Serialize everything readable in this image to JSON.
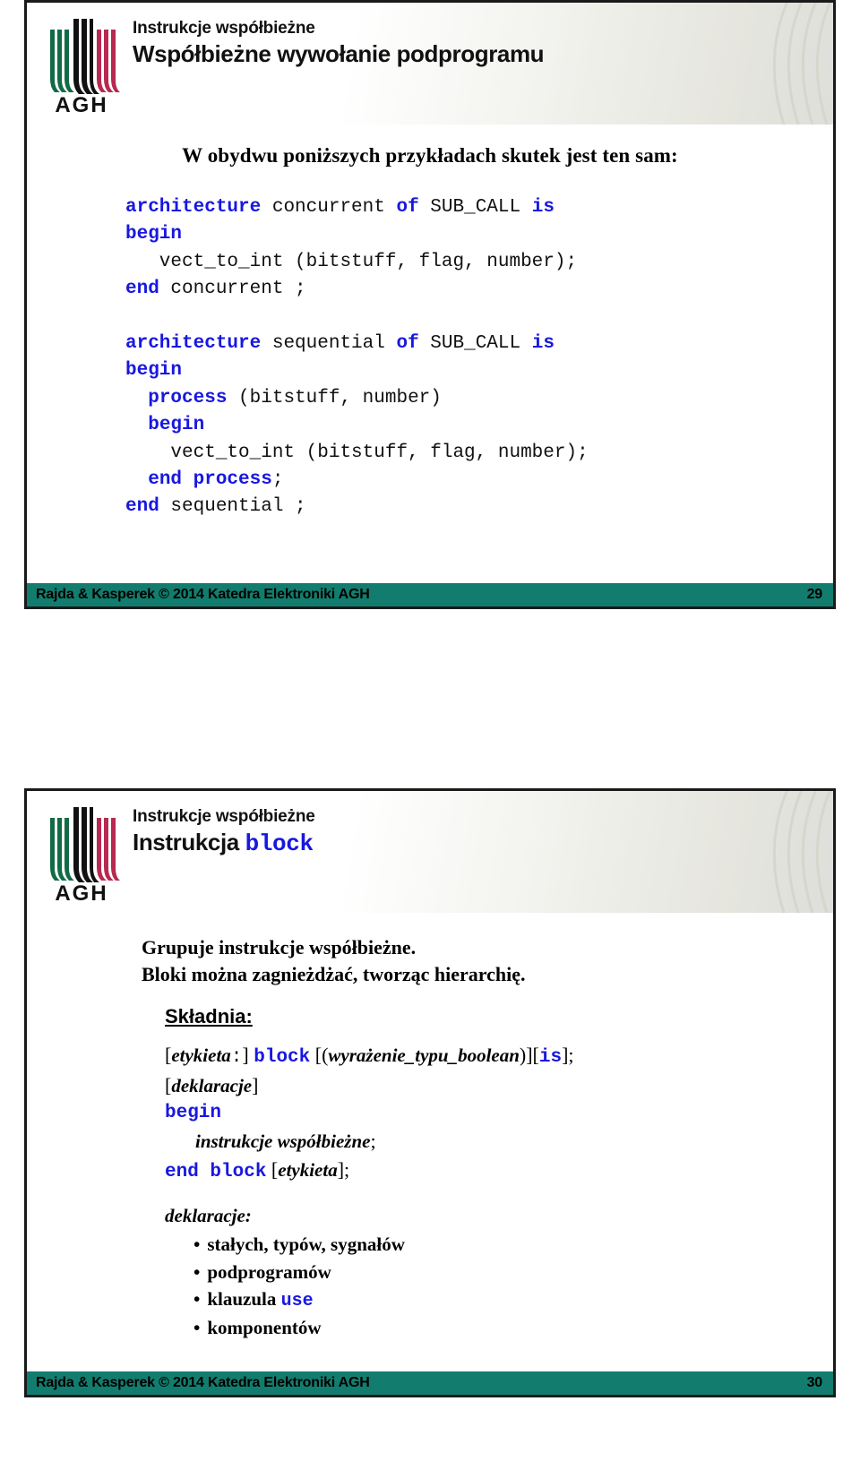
{
  "document": {
    "slides": [
      {
        "id": "slide-29",
        "header": {
          "kicker": "Instrukcje współbieżne",
          "title": "Współbieżne wywołanie podprogramu",
          "logo_text": "AGH",
          "logo_name": "agh-logo"
        },
        "lead": "W obydwu poniższych przykładach skutek jest ten sam:",
        "code_blocks": [
          {
            "name": "concurrent-example",
            "lines": [
              [
                {
                  "t": "architecture",
                  "c": "kw"
                },
                {
                  "t": " concurrent ",
                  "c": "id"
                },
                {
                  "t": "of",
                  "c": "kw"
                },
                {
                  "t": " SUB_CALL ",
                  "c": "id"
                },
                {
                  "t": "is",
                  "c": "kw"
                }
              ],
              [
                {
                  "t": "begin",
                  "c": "kw"
                }
              ],
              [
                {
                  "t": "   vect_to_int (bitstuff, flag, number);",
                  "c": "id"
                }
              ],
              [
                {
                  "t": "end",
                  "c": "kw"
                },
                {
                  "t": " concurrent ;",
                  "c": "id"
                }
              ]
            ]
          },
          {
            "name": "sequential-example",
            "lines": [
              [
                {
                  "t": "architecture",
                  "c": "kw"
                },
                {
                  "t": " sequential ",
                  "c": "id"
                },
                {
                  "t": "of",
                  "c": "kw"
                },
                {
                  "t": " SUB_CALL ",
                  "c": "id"
                },
                {
                  "t": "is",
                  "c": "kw"
                }
              ],
              [
                {
                  "t": "begin",
                  "c": "kw"
                }
              ],
              [
                {
                  "t": "  ",
                  "c": "id"
                },
                {
                  "t": "process",
                  "c": "kw"
                },
                {
                  "t": " (bitstuff, number)",
                  "c": "id"
                }
              ],
              [
                {
                  "t": "  ",
                  "c": "id"
                },
                {
                  "t": "begin",
                  "c": "kw"
                }
              ],
              [
                {
                  "t": "    vect_to_int (bitstuff, flag, number);",
                  "c": "id"
                }
              ],
              [
                {
                  "t": "  ",
                  "c": "id"
                },
                {
                  "t": "end process",
                  "c": "kw"
                },
                {
                  "t": ";",
                  "c": "id"
                }
              ],
              [
                {
                  "t": "end",
                  "c": "kw"
                },
                {
                  "t": " sequential ;",
                  "c": "id"
                }
              ]
            ]
          }
        ],
        "footer": {
          "credit": "Rajda & Kasperek © 2014 Katedra Elektroniki AGH",
          "page": "29"
        }
      },
      {
        "id": "slide-30",
        "header": {
          "kicker": "Instrukcje współbieżne",
          "title_plain": "Instrukcja ",
          "title_keyword": "block",
          "logo_text": "AGH",
          "logo_name": "agh-logo"
        },
        "paragraphs": [
          "Grupuje instrukcje współbieżne.",
          "Bloki można zagnieżdżać, tworząc hierarchię."
        ],
        "section_title": "Składnia:",
        "syntax_lines": [
          {
            "name": "syntax-line-block-header",
            "indent": 0,
            "parts": [
              {
                "t": "[",
                "c": "brk"
              },
              {
                "t": "etykieta",
                "c": "ital"
              },
              {
                "t": ":",
                "c": "mono-plain"
              },
              {
                "t": "] ",
                "c": "brk"
              },
              {
                "t": "block",
                "c": "mono-kw"
              },
              {
                "t": " [(",
                "c": "brk"
              },
              {
                "t": "wyrażenie_typu_boolean",
                "c": "ital"
              },
              {
                "t": ")][",
                "c": "brk"
              },
              {
                "t": "is",
                "c": "mono-kw"
              },
              {
                "t": "];",
                "c": "brk"
              }
            ]
          },
          {
            "name": "syntax-line-declarations",
            "indent": 0,
            "parts": [
              {
                "t": "[",
                "c": "brk"
              },
              {
                "t": "deklaracje",
                "c": "ital"
              },
              {
                "t": "]",
                "c": "brk"
              }
            ]
          },
          {
            "name": "syntax-line-begin",
            "indent": 0,
            "parts": [
              {
                "t": "begin",
                "c": "mono-kw"
              }
            ]
          },
          {
            "name": "syntax-line-statements",
            "indent": 1,
            "parts": [
              {
                "t": "instrukcje współbieżne",
                "c": "ital"
              },
              {
                "t": ";",
                "c": "brk"
              }
            ]
          },
          {
            "name": "syntax-line-end-block",
            "indent": 0,
            "parts": [
              {
                "t": "end block",
                "c": "mono-kw"
              },
              {
                "t": " [",
                "c": "brk"
              },
              {
                "t": "etykieta",
                "c": "ital"
              },
              {
                "t": "];",
                "c": "brk"
              }
            ]
          }
        ],
        "declarations_heading": "deklaracje:",
        "bullets": [
          {
            "name": "bullet-constants-types-signals",
            "text": "stałych, typów, sygnałów",
            "keyword": ""
          },
          {
            "name": "bullet-subprograms",
            "text": "podprogramów",
            "keyword": ""
          },
          {
            "name": "bullet-use-clause",
            "text": "klauzula ",
            "keyword": "use"
          },
          {
            "name": "bullet-components",
            "text": "komponentów",
            "keyword": ""
          }
        ],
        "footer": {
          "credit": "Rajda & Kasperek © 2014 Katedra Elektroniki AGH",
          "page": "30"
        }
      }
    ]
  },
  "colors": {
    "keyword_blue": "#1818e0",
    "footer_teal": "#127d6e",
    "logo_green": "#116b46",
    "logo_crimson": "#b8294f",
    "logo_black": "#111111"
  }
}
